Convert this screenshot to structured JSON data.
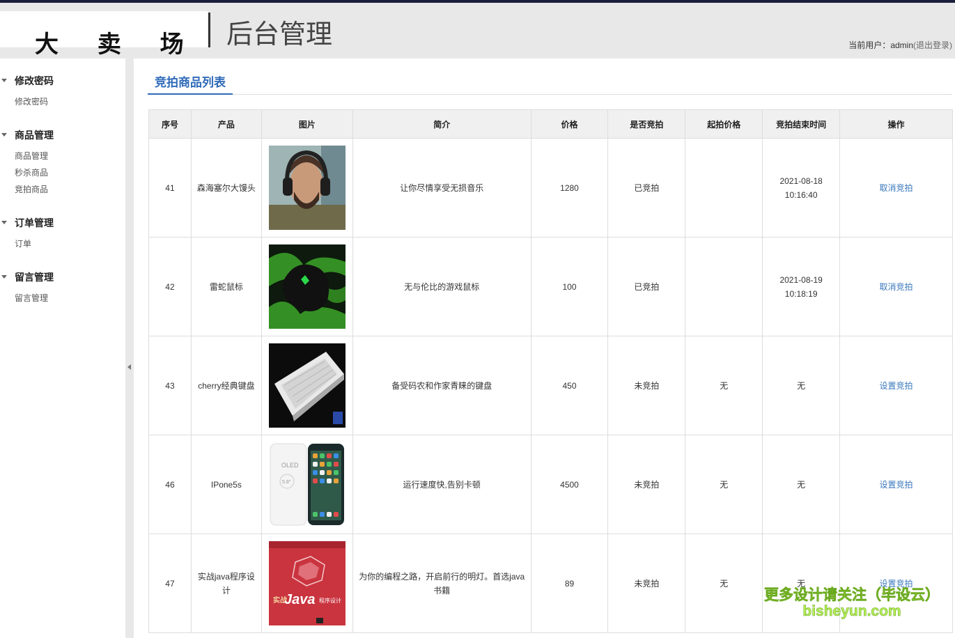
{
  "header": {
    "logo": "大 卖 场",
    "title": "后台管理",
    "user_prefix": "当前用户：",
    "user_name": "admin",
    "logout": "(退出登录)"
  },
  "sidebar": {
    "groups": [
      {
        "title": "修改密码",
        "items": [
          "修改密码"
        ]
      },
      {
        "title": "商品管理",
        "items": [
          "商品管理",
          "秒杀商品",
          "竞拍商品"
        ]
      },
      {
        "title": "订单管理",
        "items": [
          "订单"
        ]
      },
      {
        "title": "留言管理",
        "items": [
          "留言管理"
        ]
      }
    ]
  },
  "main": {
    "tab": "竞拍商品列表",
    "columns": [
      "序号",
      "产品",
      "图片",
      "简介",
      "价格",
      "是否竞拍",
      "起拍价格",
      "竞拍结束时间",
      "操作"
    ],
    "rows": [
      {
        "id": "41",
        "product": "森海塞尔大馒头",
        "image": "headphones-photo",
        "intro": "让你尽情享受无损音乐",
        "price": "1280",
        "auction": "已竞拍",
        "start_price": "",
        "end_date": "2021-08-18",
        "end_time": "10:16:40",
        "action": "取消竞拍"
      },
      {
        "id": "42",
        "product": "雷蛇鼠标",
        "image": "mouse-photo",
        "intro": "无与伦比的游戏鼠标",
        "price": "100",
        "auction": "已竞拍",
        "start_price": "",
        "end_date": "2021-08-19",
        "end_time": "10:18:19",
        "action": "取消竞拍"
      },
      {
        "id": "43",
        "product": "cherry经典键盘",
        "image": "keyboard-photo",
        "intro": "备受码农和作家青睐的键盘",
        "price": "450",
        "auction": "未竞拍",
        "start_price": "无",
        "end_date": "无",
        "end_time": "",
        "action": "设置竞拍"
      },
      {
        "id": "46",
        "product": "IPone5s",
        "image": "phone-photo",
        "intro": "运行速度快,告别卡顿",
        "price": "4500",
        "auction": "未竞拍",
        "start_price": "无",
        "end_date": "无",
        "end_time": "",
        "action": "设置竞拍"
      },
      {
        "id": "47",
        "product": "实战java程序设计",
        "image": "java-book-photo",
        "intro": "为你的编程之路，开启前行的明灯。首选java书籍",
        "price": "89",
        "auction": "未竞拍",
        "start_price": "无",
        "end_date": "无",
        "end_time": "",
        "action": "设置竞拍"
      }
    ]
  },
  "thumb_text": {
    "oled": "OLED",
    "size": "5.8\"",
    "book": "Java",
    "book_sub": "程序设计",
    "brand": "实战"
  },
  "watermark": {
    "line1": "更多设计请关注（毕设云）",
    "line2": "bisheyun.com"
  }
}
